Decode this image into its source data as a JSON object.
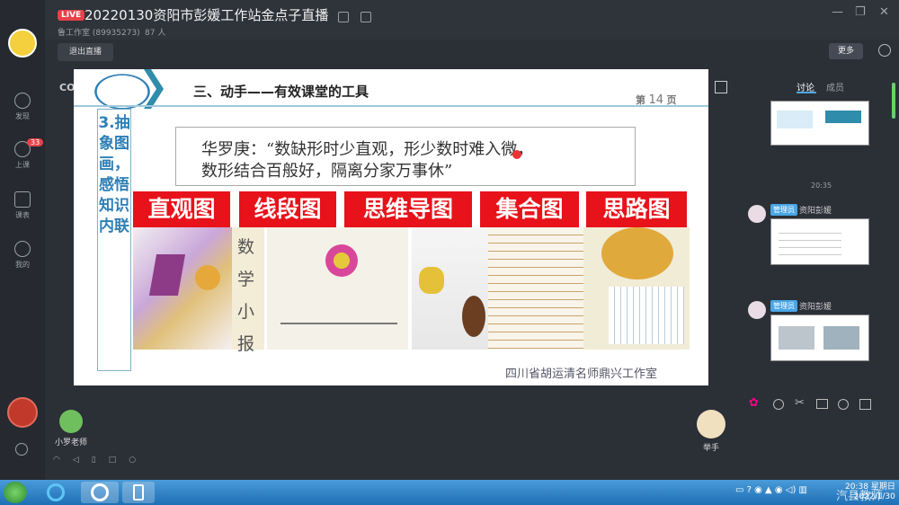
{
  "window": {
    "live_badge": "LIVE",
    "title": "20220130资阳市彭媛工作站金点子直播",
    "subtitle": "鲁工作室 (89935273)",
    "viewers": "87 人",
    "controls": [
      "—",
      "❐",
      "✕"
    ]
  },
  "toolbar": {
    "exit_label": "退出直播",
    "more_label": "更多"
  },
  "sidebar": {
    "items": [
      {
        "label": "发现",
        "icon": "compass-icon"
      },
      {
        "label": "上课",
        "icon": "chat-icon",
        "badge": "33"
      },
      {
        "label": "课表",
        "icon": "calendar-icon"
      },
      {
        "label": "我的",
        "icon": "person-icon"
      }
    ]
  },
  "slide": {
    "watermark_left": "CO",
    "header": "三、动手——有效课堂的工具",
    "page_prefix": "第",
    "page_number": "14",
    "page_suffix": "页",
    "left_text": "3.抽象图画，感悟知识内联",
    "quote_line1": "华罗庚：“数缺形时少直观，形少数时难入微，",
    "quote_line2": "数形结合百般好，隔离分家万事休”",
    "red_labels": [
      "直观图",
      "线段图",
      "思维导图",
      "集合图",
      "思路图"
    ],
    "photo_caption": "数学小报",
    "footer_watermark": "四川省胡运清名师鼎兴工作室"
  },
  "panel": {
    "tabs": [
      "讨论",
      "成员"
    ],
    "time": "20:35",
    "messages": [
      {
        "role": "管理员",
        "name": "资阳彭媛"
      },
      {
        "role": "管理员",
        "name": "资阳彭媛"
      }
    ]
  },
  "bottom": {
    "teacher_name": "小罗老师",
    "raise_hand": "举手"
  },
  "taskbar": {
    "time": "20:38",
    "weekday": "星期日",
    "date": "2022/1/30",
    "overlay": "汽县教师"
  },
  "colors": {
    "accent_red": "#e8121a",
    "live_red": "#e8414a",
    "admin_blue": "#4aa7e6"
  }
}
